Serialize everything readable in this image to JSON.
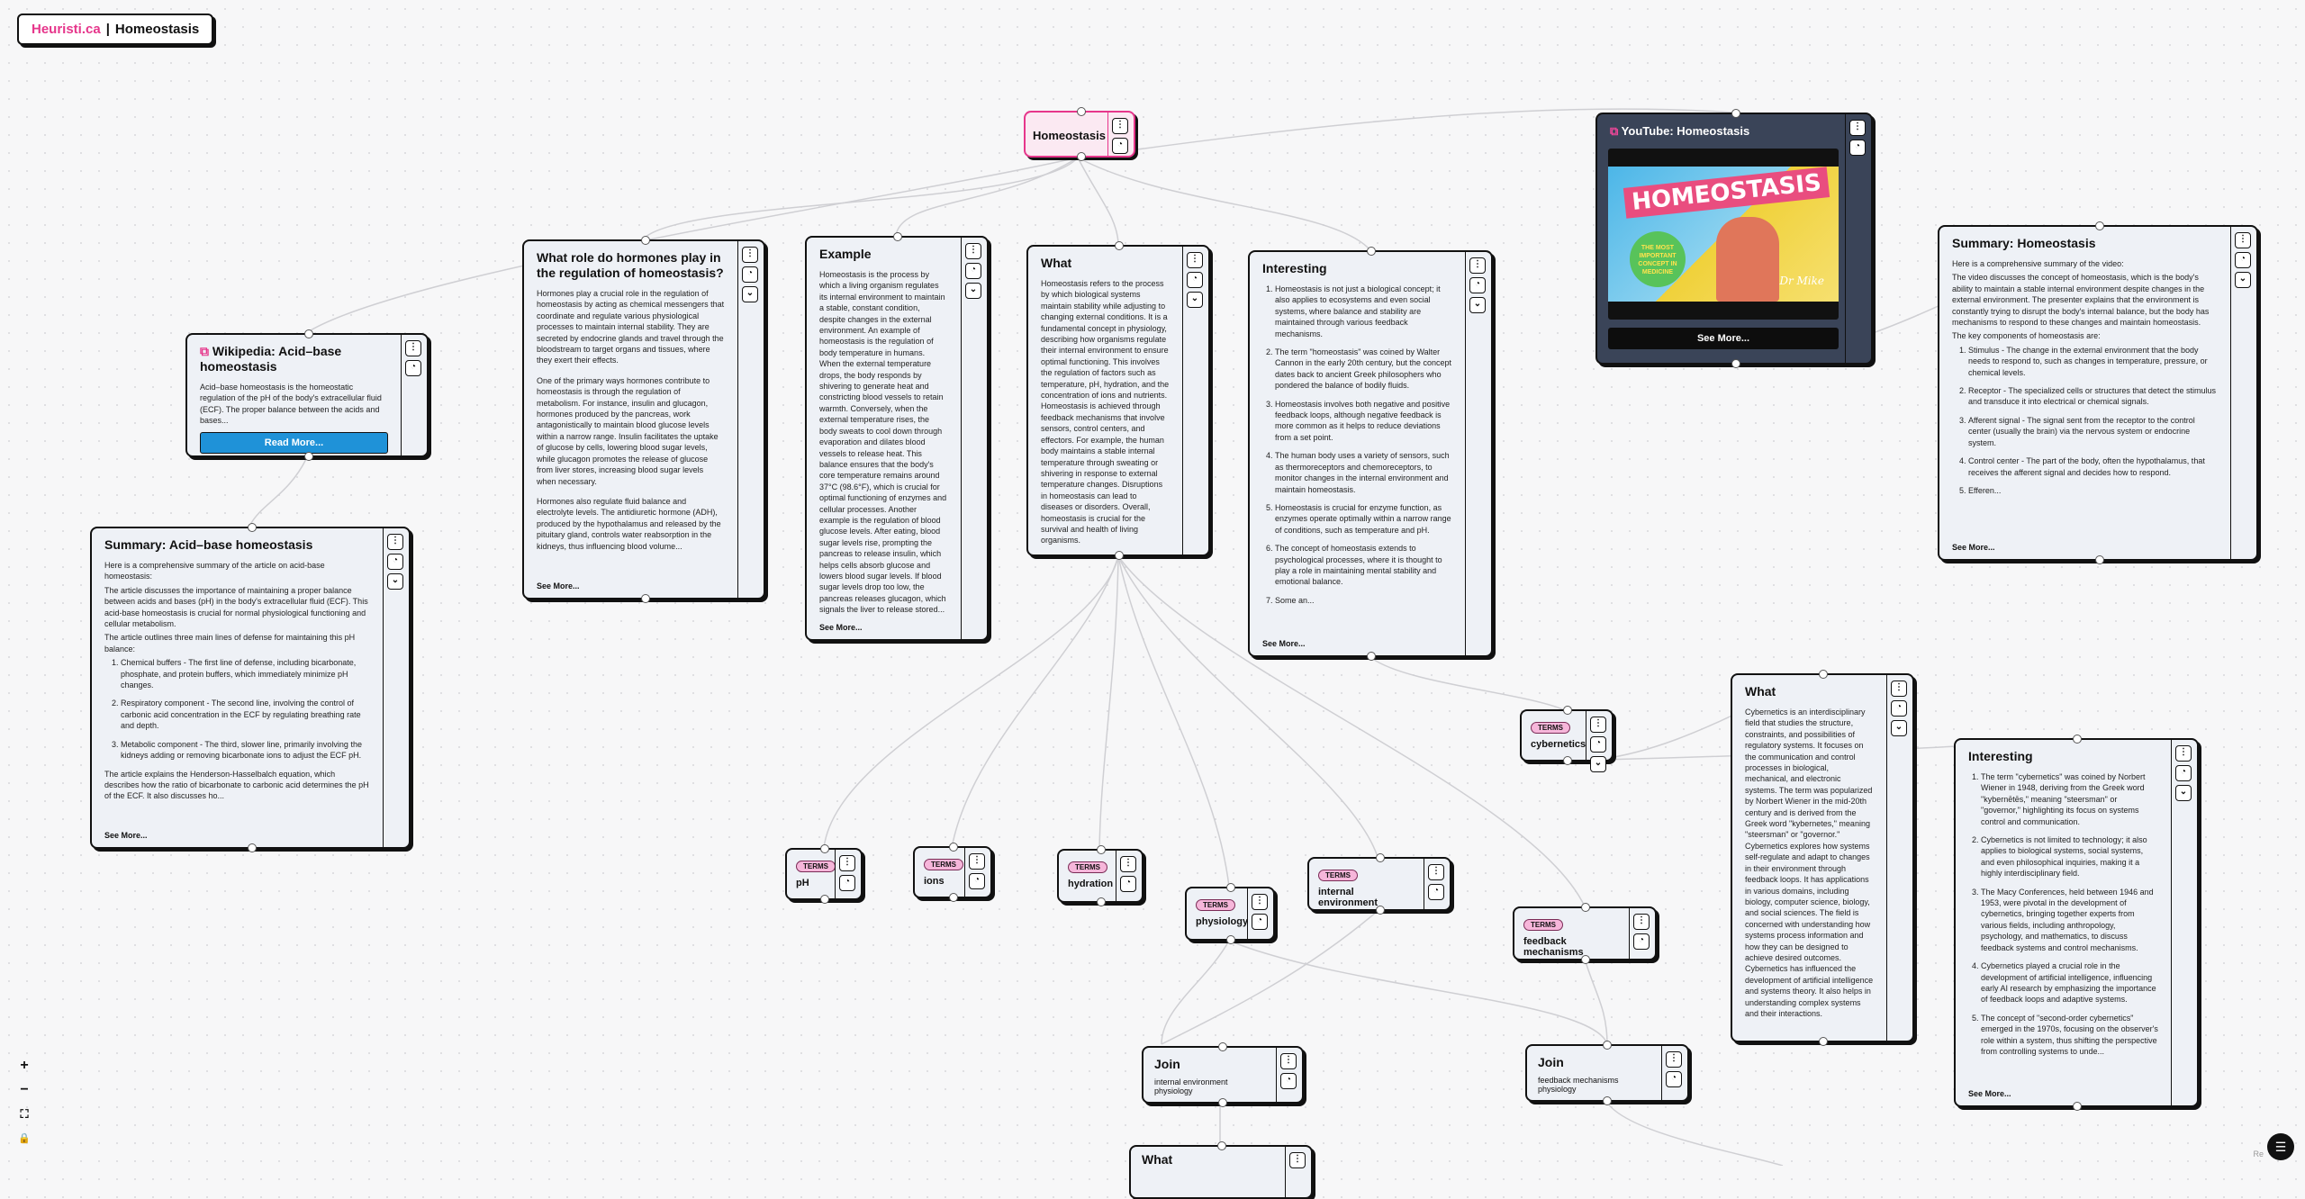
{
  "header": {
    "site": "Heuristi.ca",
    "separator": "|",
    "title": "Homeostasis"
  },
  "root": {
    "title": "Homeostasis"
  },
  "controls": {
    "more_icon": "⋮",
    "ai_icon": "◔",
    "collapse_icon": "⌄",
    "zoom_in": "+",
    "zoom_out": "−",
    "fit": "⛶",
    "lock": "🔒",
    "menu": "☰"
  },
  "hormones": {
    "title": "What role do hormones play in the regulation of homeostasis?",
    "p1": "Hormones play a crucial role in the regulation of homeostasis by acting as chemical messengers that coordinate and regulate various physiological processes to maintain internal stability. They are secreted by endocrine glands and travel through the bloodstream to target organs and tissues, where they exert their effects.",
    "p2": "One of the primary ways hormones contribute to homeostasis is through the regulation of metabolism. For instance, insulin and glucagon, hormones produced by the pancreas, work antagonistically to maintain blood glucose levels within a narrow range. Insulin facilitates the uptake of glucose by cells, lowering blood sugar levels, while glucagon promotes the release of glucose from liver stores, increasing blood sugar levels when necessary.",
    "p3": "Hormones also regulate fluid balance and electrolyte levels. The antidiuretic hormone (ADH), produced by the hypothalamus and released by the pituitary gland, controls water reabsorption in the kidneys, thus influencing blood volume...",
    "see_more": "See More..."
  },
  "example": {
    "title": "Example",
    "text": "Homeostasis is the process by which a living organism regulates its internal environment to maintain a stable, constant condition, despite changes in the external environment. An example of homeostasis is the regulation of body temperature in humans. When the external temperature drops, the body responds by shivering to generate heat and constricting blood vessels to retain warmth. Conversely, when the external temperature rises, the body sweats to cool down through evaporation and dilates blood vessels to release heat. This balance ensures that the body's core temperature remains around 37°C (98.6°F), which is crucial for optimal functioning of enzymes and cellular processes. Another example is the regulation of blood glucose levels. After eating, blood sugar levels rise, prompting the pancreas to release insulin, which helps cells absorb glucose and lowers blood sugar levels. If blood sugar levels drop too low, the pancreas releases glucagon, which signals the liver to release stored...",
    "see_more": "See More..."
  },
  "what": {
    "title": "What",
    "text": "Homeostasis refers to the process by which biological systems maintain stability while adjusting to changing external conditions. It is a fundamental concept in physiology, describing how organisms regulate their internal environment to ensure optimal functioning. This involves the regulation of factors such as temperature, pH, hydration, and the concentration of ions and nutrients. Homeostasis is achieved through feedback mechanisms that involve sensors, control centers, and effectors. For example, the human body maintains a stable internal temperature through sweating or shivering in response to external temperature changes. Disruptions in homeostasis can lead to diseases or disorders. Overall, homeostasis is crucial for the survival and health of living organisms."
  },
  "interesting": {
    "title": "Interesting",
    "items": [
      "Homeostasis is not just a biological concept; it also applies to ecosystems and even social systems, where balance and stability are maintained through various feedback mechanisms.",
      "The term \"homeostasis\" was coined by Walter Cannon in the early 20th century, but the concept dates back to ancient Greek philosophers who pondered the balance of bodily fluids.",
      "Homeostasis involves both negative and positive feedback loops, although negative feedback is more common as it helps to reduce deviations from a set point.",
      "The human body uses a variety of sensors, such as thermoreceptors and chemoreceptors, to monitor changes in the internal environment and maintain homeostasis.",
      "Homeostasis is crucial for enzyme function, as enzymes operate optimally within a narrow range of conditions, such as temperature and pH.",
      "The concept of homeostasis extends to psychological processes, where it is thought to play a role in maintaining mental stability and emotional balance.",
      "Some an..."
    ],
    "see_more": "See More..."
  },
  "youtube": {
    "title": "YouTube: Homeostasis",
    "thumb_title": "HOMEOSTASIS",
    "thumb_badge": "THE MOST IMPORTANT CONCEPT IN MEDICINE",
    "thumb_sig": "Dr Mike",
    "see_more": "See More..."
  },
  "summary_h": {
    "title": "Summary: Homeostasis",
    "intro": "Here is a comprehensive summary of the video:",
    "p1": "The video discusses the concept of homeostasis, which is the body's ability to maintain a stable internal environment despite changes in the external environment. The presenter explains that the environment is constantly trying to disrupt the body's internal balance, but the body has mechanisms to respond to these changes and maintain homeostasis.",
    "p2": "The key components of homeostasis are:",
    "items": [
      "Stimulus - The change in the external environment that the body needs to respond to, such as changes in temperature, pressure, or chemical levels.",
      "Receptor - The specialized cells or structures that detect the stimulus and transduce it into electrical or chemical signals.",
      "Afferent signal - The signal sent from the receptor to the control center (usually the brain) via the nervous system or endocrine system.",
      "Control center - The part of the body, often the hypothalamus, that receives the afferent signal and decides how to respond.",
      "Efferen..."
    ],
    "see_more": "See More..."
  },
  "wiki": {
    "title": "Wikipedia: Acid–base homeostasis",
    "text": "Acid–base homeostasis is the homeostatic regulation of the pH of the body's extracellular fluid (ECF). The proper balance between the acids and bases...",
    "button": "Read More..."
  },
  "summary_ab": {
    "title": "Summary: Acid–base homeostasis",
    "intro": "Here is a comprehensive summary of the article on acid-base homeostasis:",
    "p1": "The article discusses the importance of maintaining a proper balance between acids and bases (pH) in the body's extracellular fluid (ECF). This acid-base homeostasis is crucial for normal physiological functioning and cellular metabolism.",
    "p2": "The article outlines three main lines of defense for maintaining this pH balance:",
    "items": [
      "Chemical buffers - The first line of defense, including bicarbonate, phosphate, and protein buffers, which immediately minimize pH changes.",
      "Respiratory component - The second line, involving the control of carbonic acid concentration in the ECF by regulating breathing rate and depth.",
      "Metabolic component - The third, slower line, primarily involving the kidneys adding or removing bicarbonate ions to adjust the ECF pH."
    ],
    "p3": "The article explains the Henderson-Hasselbalch equation, which describes how the ratio of bicarbonate to carbonic acid determines the pH of the ECF. It also discusses ho...",
    "see_more": "See More..."
  },
  "terms": {
    "label": "TERMS",
    "ph": "pH",
    "ions": "ions",
    "hydration": "hydration",
    "physiology": "physiology",
    "internal": "internal environment",
    "feedback": "feedback mechanisms",
    "cybernetics": "cybernetics"
  },
  "cyber_what": {
    "title": "What",
    "text": "Cybernetics is an interdisciplinary field that studies the structure, constraints, and possibilities of regulatory systems. It focuses on the communication and control processes in biological, mechanical, and electronic systems. The term was popularized by Norbert Wiener in the mid-20th century and is derived from the Greek word \"kybernetes,\" meaning \"steersman\" or \"governor.\" Cybernetics explores how systems self-regulate and adapt to changes in their environment through feedback loops. It has applications in various domains, including biology, computer science, biology, and social sciences. The field is concerned with understanding how systems process information and how they can be designed to achieve desired outcomes. Cybernetics has influenced the development of artificial intelligence and systems theory. It also helps in understanding complex systems and their interactions."
  },
  "cyber_int": {
    "title": "Interesting",
    "items": [
      "The term \"cybernetics\" was coined by Norbert Wiener in 1948, deriving from the Greek word \"kybernētēs,\" meaning \"steersman\" or \"governor,\" highlighting its focus on systems control and communication.",
      "Cybernetics is not limited to technology; it also applies to biological systems, social systems, and even philosophical inquiries, making it a highly interdisciplinary field.",
      "The Macy Conferences, held between 1946 and 1953, were pivotal in the development of cybernetics, bringing together experts from various fields, including anthropology, psychology, and mathematics, to discuss feedback systems and control mechanisms.",
      "Cybernetics played a crucial role in the development of artificial intelligence, influencing early AI research by emphasizing the importance of feedback loops and adaptive systems.",
      "The concept of \"second-order cybernetics\" emerged in the 1970s, focusing on the observer's role within a system, thus shifting the perspective from controlling systems to unde..."
    ],
    "see_more": "See More..."
  },
  "join1": {
    "title": "Join",
    "sub": "internal environment physiology"
  },
  "join2": {
    "title": "Join",
    "sub": "feedback mechanisms physiology"
  },
  "bottom_what": {
    "title": "What"
  },
  "attribution": "Re"
}
